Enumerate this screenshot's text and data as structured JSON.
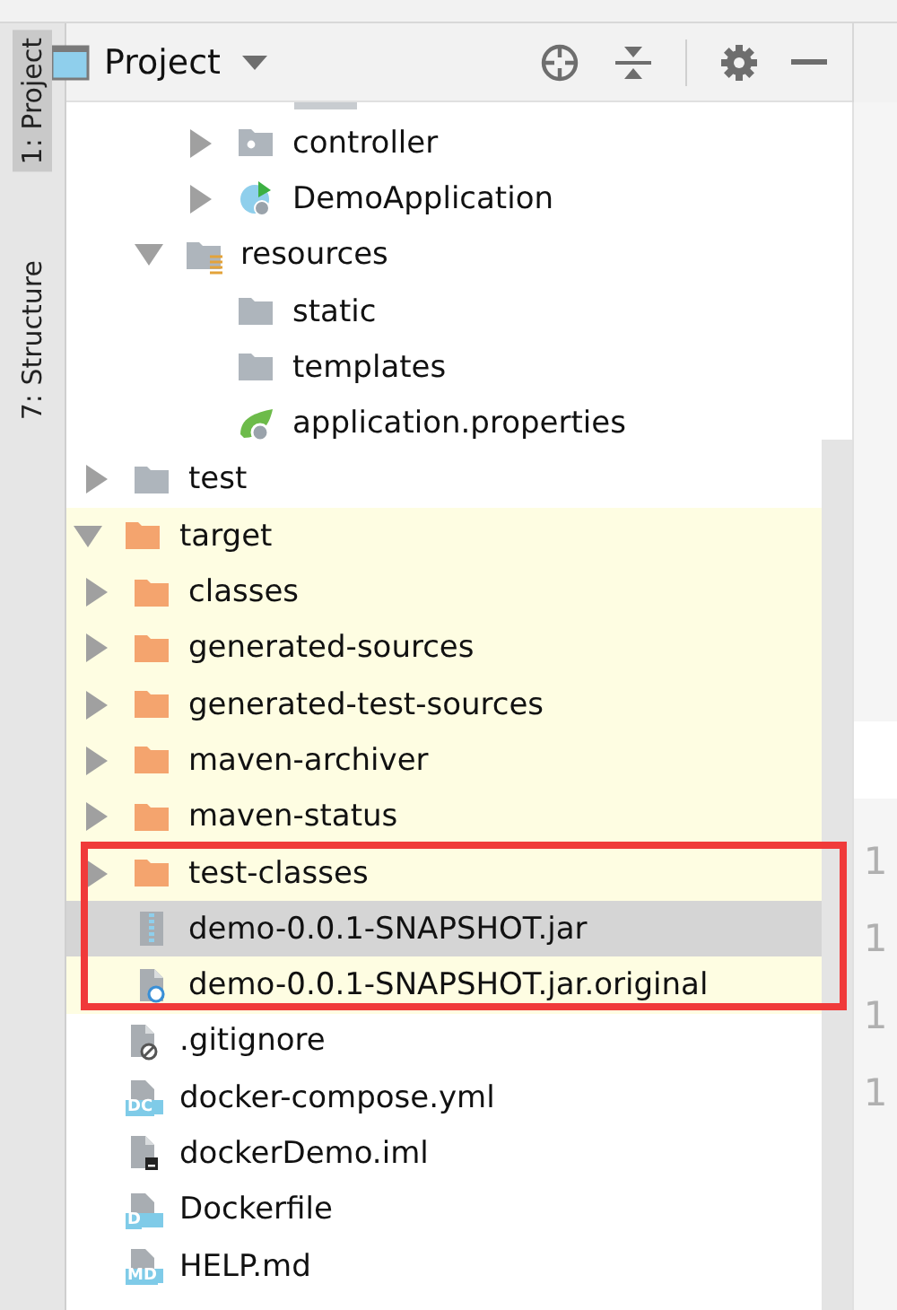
{
  "side_strip": {
    "tabs": [
      {
        "label": "1: Project",
        "selected": true
      },
      {
        "label": "7: Structure",
        "selected": false
      }
    ]
  },
  "panel": {
    "title": "Project",
    "toolbar": [
      {
        "kind": "locate"
      },
      {
        "kind": "collapse"
      },
      {
        "kind": "settings"
      },
      {
        "kind": "minimize"
      }
    ]
  },
  "tree": {
    "items": [
      {
        "children": [
          {
            "children": [
              {
                "children": [
                  {
                    "label": "controller",
                    "kind": "package",
                    "expanded": false,
                    "selected": false
                  },
                  {
                    "label": "DemoApplication",
                    "kind": "spring-class",
                    "expanded": false,
                    "selected": false
                  }
                ]
              },
              {
                "label": "resources",
                "kind": "resources-folder",
                "expanded": true,
                "selected": false,
                "children": [
                  {
                    "label": "static",
                    "kind": "folder",
                    "selected": false
                  },
                  {
                    "label": "templates",
                    "kind": "folder",
                    "selected": false
                  },
                  {
                    "label": "application.properties",
                    "kind": "spring-config",
                    "selected": false
                  }
                ]
              }
            ]
          },
          {
            "label": "test",
            "kind": "folder",
            "expanded": false,
            "selected": false
          }
        ]
      },
      {
        "label": "target",
        "kind": "excluded-folder",
        "expanded": true,
        "excluded": true,
        "selected": false,
        "children": [
          {
            "label": "classes",
            "kind": "excluded-folder",
            "expanded": false,
            "selected": false
          },
          {
            "label": "generated-sources",
            "kind": "excluded-folder",
            "expanded": false,
            "selected": false
          },
          {
            "label": "generated-test-sources",
            "kind": "excluded-folder",
            "expanded": false,
            "selected": false
          },
          {
            "label": "maven-archiver",
            "kind": "excluded-folder",
            "expanded": false,
            "selected": false
          },
          {
            "label": "maven-status",
            "kind": "excluded-folder",
            "expanded": false,
            "selected": false
          },
          {
            "label": "test-classes",
            "kind": "excluded-folder",
            "expanded": false,
            "selected": false
          },
          {
            "label": "demo-0.0.1-SNAPSHOT.jar",
            "kind": "archive",
            "selected": true
          },
          {
            "label": "demo-0.0.1-SNAPSHOT.jar.original",
            "kind": "linked-file",
            "selected": false
          }
        ]
      },
      {
        "label": ".gitignore",
        "kind": "ignore-file",
        "selected": false
      },
      {
        "label": "docker-compose.yml",
        "kind": "badge-file",
        "badge": "DC",
        "selected": false
      },
      {
        "label": "dockerDemo.iml",
        "kind": "module-file",
        "selected": false
      },
      {
        "label": "Dockerfile",
        "kind": "badge-file",
        "badge": "D",
        "selected": false
      },
      {
        "label": "HELP.md",
        "kind": "badge-file",
        "badge": "MD",
        "selected": false
      }
    ]
  },
  "annotation": {
    "kind": "rectangle",
    "color": "#f03a3a"
  },
  "editor_gutter": {
    "line_numbers": [
      "1",
      "1",
      "1",
      "1"
    ]
  }
}
